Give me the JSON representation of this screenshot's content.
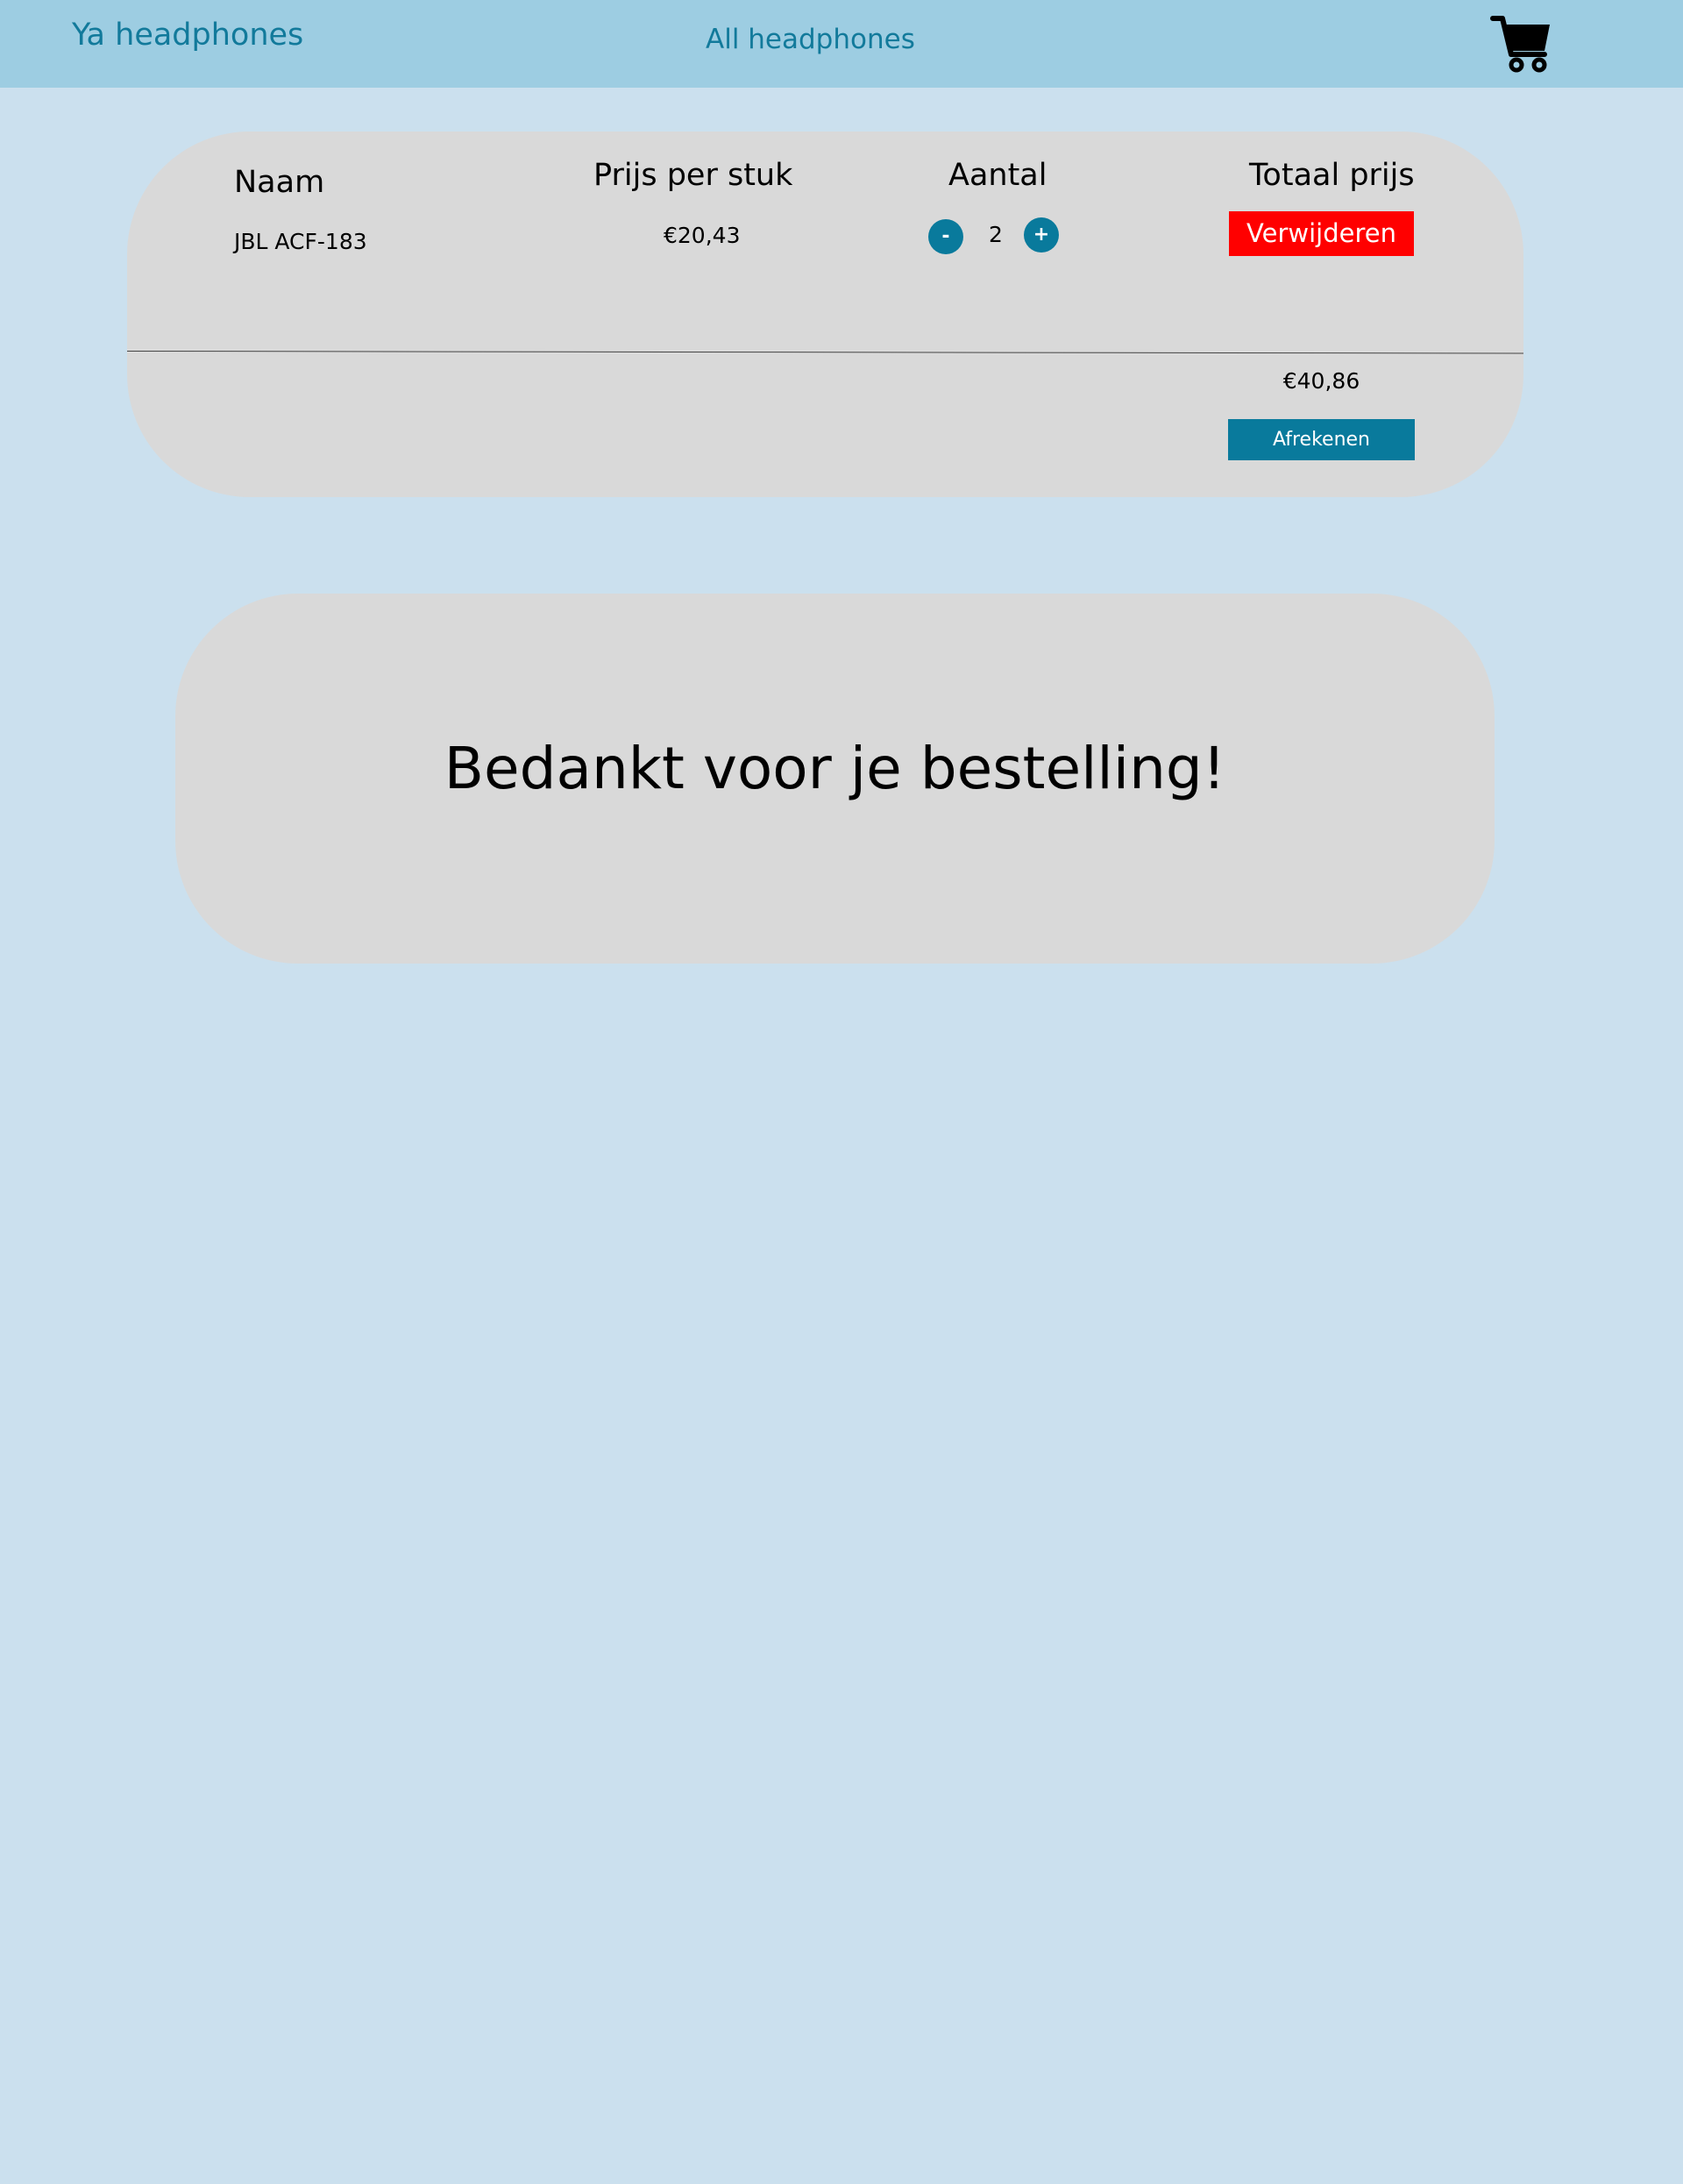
{
  "nav": {
    "brand": "Ya headphones",
    "all_link": "All headphones",
    "cart_icon": "shopping-cart-icon"
  },
  "cart": {
    "headers": {
      "name": "Naam",
      "unit_price": "Prijs per stuk",
      "quantity": "Aantal",
      "total_price": "Totaal prijs"
    },
    "items": [
      {
        "name": "JBL ACF-183",
        "unit_price": "€20,43",
        "quantity": "2",
        "decrease_label": "-",
        "increase_label": "+",
        "remove_label": "Verwijderen"
      }
    ],
    "total": "€40,86",
    "checkout_label": "Afrekenen"
  },
  "confirmation": {
    "message": "Bedankt voor je bestelling!"
  },
  "colors": {
    "page_background": "#cbe0ee",
    "navbar": "#9dcde2",
    "accent": "#097a9c",
    "remove": "#ff0000",
    "panel": "#d9d9d9"
  }
}
